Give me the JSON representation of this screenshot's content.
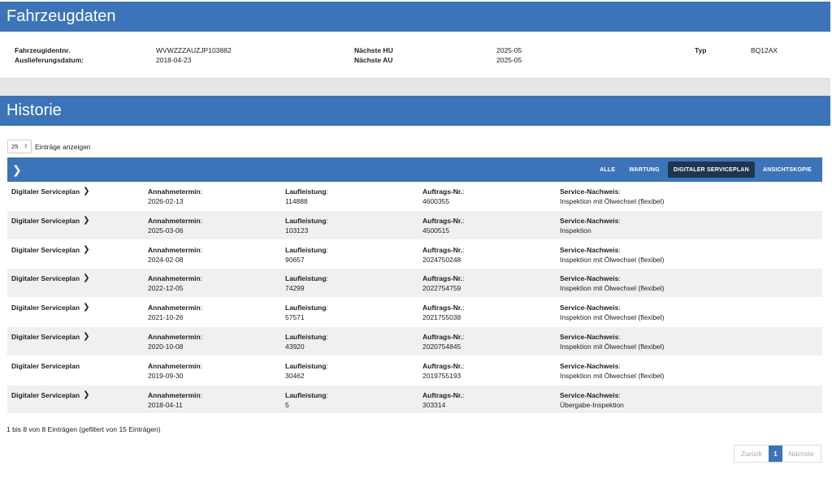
{
  "vehicle_section": {
    "title": "Fahrzeugdaten",
    "fields": {
      "fin_label": "Fahrzeugidentnr.",
      "fin_value": "WVWZZZAUZJP103882",
      "delivery_label": "Auslieferungsdatum:",
      "delivery_value": "2018-04-23",
      "hu_label": "Nächste HU",
      "hu_value": "2025-05",
      "au_label": "Nächste AU",
      "au_value": "2025-05",
      "type_label": "Typ",
      "type_value": "BQ12AX"
    }
  },
  "history_section": {
    "title": "Historie",
    "length_value": "25",
    "length_label": "Einträge anzeigen",
    "filters": [
      "ALLE",
      "WARTUNG",
      "DIGITALER SERVICEPLAN",
      "ANSICHTSKOPIE"
    ],
    "labels": {
      "date": "Annahmetermin",
      "mileage": "Laufleistung",
      "order": "Auftrags-Nr.",
      "proof": "Service-Nachweis"
    },
    "rows": [
      {
        "type": "Digitaler Serviceplan",
        "arrow": "❯",
        "date": "2026-02-13",
        "mileage": "114888",
        "order": "4600355",
        "proof": "Inspektion mit Ölwechsel (flexibel)"
      },
      {
        "type": "Digitaler Serviceplan",
        "arrow": "❯",
        "date": "2025-03-06",
        "mileage": "103123",
        "order": "4500515",
        "proof": "Inspektion"
      },
      {
        "type": "Digitaler Serviceplan",
        "arrow": "❯",
        "date": "2024-02-08",
        "mileage": "90657",
        "order": "2024750248",
        "proof": "Inspektion mit Ölwechsel (flexibel)"
      },
      {
        "type": "Digitaler Serviceplan",
        "arrow": "❯",
        "date": "2022-12-05",
        "mileage": "74299",
        "order": "2022754759",
        "proof": "Inspektion mit Ölwechsel (flexibel)"
      },
      {
        "type": "Digitaler Serviceplan",
        "arrow": "❯",
        "date": "2021-10-26",
        "mileage": "57571",
        "order": "2021755038",
        "proof": "Inspektion mit Ölwechsel (flexibel)"
      },
      {
        "type": "Digitaler Serviceplan",
        "arrow": "❯",
        "date": "2020-10-08",
        "mileage": "43920",
        "order": "2020754845",
        "proof": "Inspektion mit Ölwechsel (flexibel)"
      },
      {
        "type": "Digitaler Serviceplan",
        "arrow": "",
        "date": "2019-09-30",
        "mileage": "30462",
        "order": "2019755193",
        "proof": "Inspektion mit Ölwechsel (flexibel)"
      },
      {
        "type": "Digitaler Serviceplan",
        "arrow": "❯",
        "date": "2018-04-11",
        "mileage": "5",
        "order": "303314",
        "proof": "Übergabe-Inspektion"
      }
    ],
    "info": "1 bis 8 von 8 Einträgen (gefiltert von 15 Einträgen)",
    "pagination": {
      "prev": "Zurück",
      "current": "1",
      "next": "Nächste"
    }
  },
  "colors": {
    "accent": "#3b74b8",
    "active_filter": "#1f3550"
  }
}
